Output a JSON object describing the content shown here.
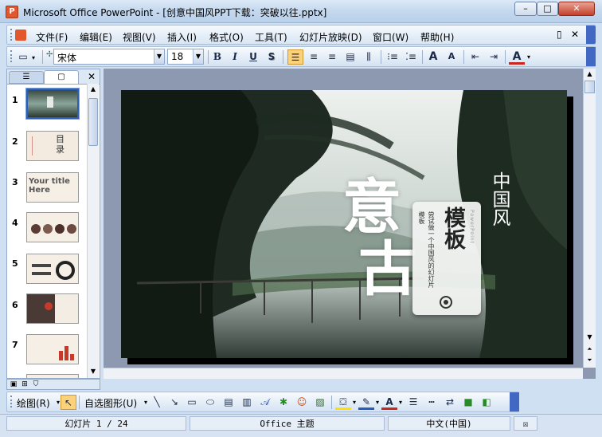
{
  "window": {
    "title": "Microsoft Office PowerPoint - [创意中国风PPT下载：突破以往.pptx]",
    "app_icon": "P",
    "minimize": "–",
    "maximize": "□",
    "close": "✕"
  },
  "menu": {
    "items": [
      "文件(F)",
      "编辑(E)",
      "视图(V)",
      "插入(I)",
      "格式(O)",
      "工具(T)",
      "幻灯片放映(D)",
      "窗口(W)",
      "帮助(H)"
    ],
    "restore": "▯",
    "close": "✕"
  },
  "toolbar": {
    "font_name": "宋体",
    "font_size": "18",
    "bold": "B",
    "italic": "I",
    "underline": "U",
    "shadow": "S",
    "font_color": "A"
  },
  "slides_pane": {
    "numbers": [
      "1",
      "2",
      "3",
      "4",
      "5",
      "6",
      "7"
    ],
    "thumb2_text": "目录",
    "thumb3_text": "Your title Here",
    "close": "✕"
  },
  "slide": {
    "big_char_1": "意",
    "big_char_2": "古",
    "card_title": "模板",
    "card_desc": "尝试做一个中国风的幻灯片模板",
    "card_sub": "PowerPoint",
    "right_text": "中国风"
  },
  "drawbar": {
    "draw_label": "绘图(R)",
    "autoshape_label": "自选图形(U)",
    "font_color": "A"
  },
  "status": {
    "slide_counter": "幻灯片 1 / 24",
    "theme": "Office 主题",
    "language": "中文(中国)"
  },
  "colors": {
    "accent": "#4169c4",
    "titlebar": "#c4d8ee",
    "workspace": "#8d99b0"
  }
}
